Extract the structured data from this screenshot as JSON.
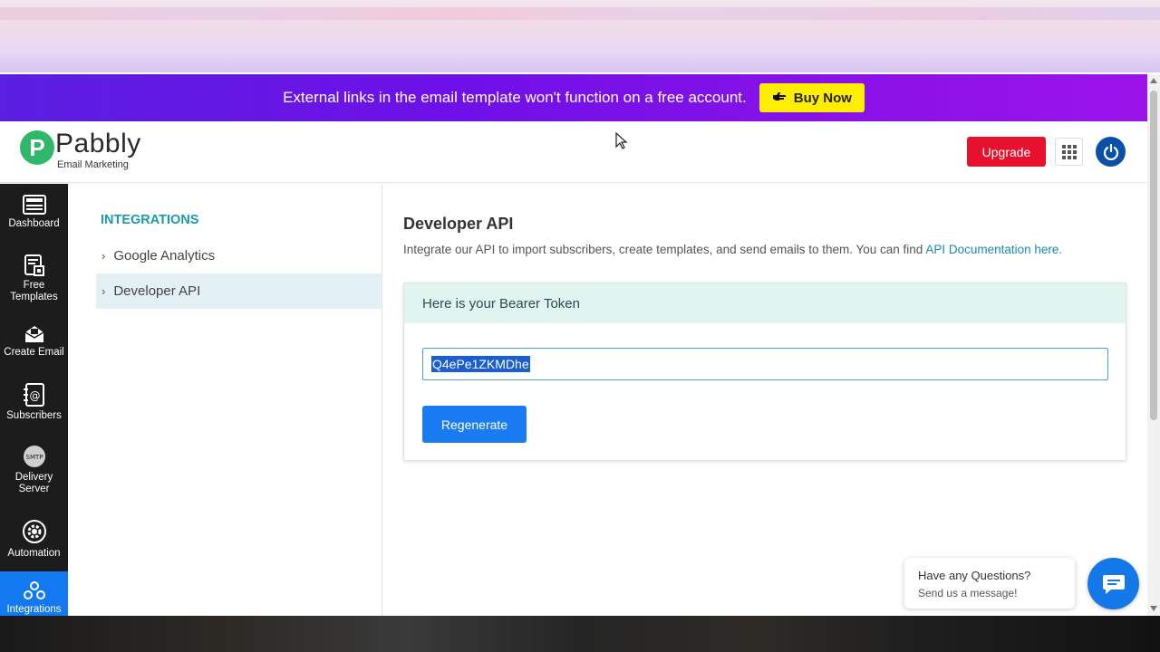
{
  "promo": {
    "text": "External links in the email template won't function on a free account.",
    "button_label": "Buy Now"
  },
  "brand": {
    "logo_letter": "P",
    "name": "Pabbly",
    "subtitle": "Email Marketing"
  },
  "header": {
    "upgrade_label": "Upgrade"
  },
  "sidenav": {
    "items": [
      {
        "label": "Dashboard",
        "icon": "dashboard-icon"
      },
      {
        "label": "Free Templates",
        "icon": "templates-icon"
      },
      {
        "label": "Create Email",
        "icon": "envelope-icon"
      },
      {
        "label": "Subscribers",
        "icon": "address-book-icon"
      },
      {
        "label": "Delivery Server",
        "icon": "smtp-icon"
      },
      {
        "label": "Automation",
        "icon": "gear-icon"
      },
      {
        "label": "Integrations",
        "icon": "integrations-icon"
      }
    ],
    "smtp_badge": "SMTP"
  },
  "subnav": {
    "title": "INTEGRATIONS",
    "items": [
      {
        "label": "Google Analytics"
      },
      {
        "label": "Developer API"
      }
    ]
  },
  "main": {
    "title": "Developer API",
    "description": "Integrate our API to import subscribers, create templates, and send emails to them. You can find ",
    "doc_link": "API Documentation here.",
    "card_title": "Here is your Bearer Token",
    "token_value": "Q4ePe1ZKMDhe",
    "regenerate_label": "Regenerate"
  },
  "chat": {
    "question": "Have any Questions?",
    "prompt": "Send us a message!"
  },
  "colors": {
    "promo_gradient_start": "#5a1fe0",
    "promo_gradient_end": "#9b14ea",
    "buy_button": "#ffee00",
    "upgrade_button": "#e8112d",
    "sidenav_bg": "#1c1c1c",
    "active_nav": "#1279f0",
    "accent_teal": "#1a9ab1",
    "primary_button": "#1a7cf3"
  }
}
